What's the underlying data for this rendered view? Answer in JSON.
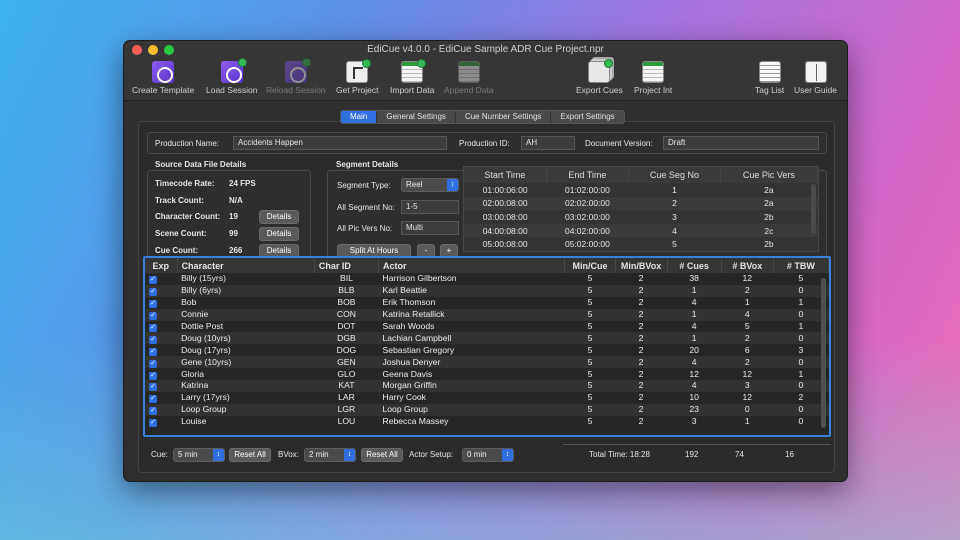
{
  "window": {
    "title": "EdiCue v4.0.0 - EdiCue Sample ADR Cue Project.npr"
  },
  "toolbar": {
    "create_template": "Create Template",
    "load_session": "Load Session",
    "reload_session": "Reload Session",
    "get_project": "Get Project",
    "import_data": "Import Data",
    "append_data": "Append Data",
    "export_cues": "Export Cues",
    "project_int": "Project Int",
    "tag_list": "Tag List",
    "user_guide": "User Guide"
  },
  "tabs": [
    "Main",
    "General Settings",
    "Cue Number Settings",
    "Export Settings"
  ],
  "production": {
    "name_label": "Production Name:",
    "name": "Accidents Happen",
    "id_label": "Production ID:",
    "id": "AH",
    "version_label": "Document Version:",
    "version": "Draft"
  },
  "source": {
    "heading": "Source Data File Details",
    "timecode_label": "Timecode Rate:",
    "timecode": "24 FPS",
    "track_label": "Track Count:",
    "track": "N/A",
    "char_label": "Character Count:",
    "char": "19",
    "scene_label": "Scene Count:",
    "scene": "99",
    "cue_label": "Cue Count:",
    "cue": "266",
    "details": "Details"
  },
  "segment": {
    "heading": "Segment Details",
    "type_label": "Segment Type:",
    "type": "Reel",
    "all_no_label": "All Segment No:",
    "all_no": "1-5",
    "all_pic_label": "All Pic Vers No:",
    "all_pic": "Multi",
    "split_btn": "Split At Hours",
    "minus": "-",
    "plus": "+",
    "columns": [
      "Start Time",
      "End Time",
      "Cue Seg No",
      "Cue Pic Vers"
    ],
    "rows": [
      [
        "01:00:06:00",
        "01:02:00:00",
        "1",
        "2a"
      ],
      [
        "02:00:08:00",
        "02:02:00:00",
        "2",
        "2a"
      ],
      [
        "03:00:08:00",
        "03:02:00:00",
        "3",
        "2b"
      ],
      [
        "04:00:08:00",
        "04:02:00:00",
        "4",
        "2c"
      ],
      [
        "05:00:08:00",
        "05:02:00:00",
        "5",
        "2b"
      ]
    ]
  },
  "characters": {
    "columns": [
      "Exp",
      "Character",
      "Char ID",
      "Actor",
      "Min/Cue",
      "Min/BVox",
      "# Cues",
      "# BVox",
      "# TBW"
    ],
    "rows": [
      [
        "Billy (15yrs)",
        "BIL",
        "Harrison Gilbertson",
        "5",
        "2",
        "38",
        "12",
        "5"
      ],
      [
        "Billy (6yrs)",
        "BLB",
        "Karl Beattie",
        "5",
        "2",
        "1",
        "2",
        "0"
      ],
      [
        "Bob",
        "BOB",
        "Erik Thomson",
        "5",
        "2",
        "4",
        "1",
        "1"
      ],
      [
        "Connie",
        "CON",
        "Katrina Retallick",
        "5",
        "2",
        "1",
        "4",
        "0"
      ],
      [
        "Dottie Post",
        "DOT",
        "Sarah Woods",
        "5",
        "2",
        "4",
        "5",
        "1"
      ],
      [
        "Doug (10yrs)",
        "DGB",
        "Lachian Campbell",
        "5",
        "2",
        "1",
        "2",
        "0"
      ],
      [
        "Doug (17yrs)",
        "DOG",
        "Sebastian Gregory",
        "5",
        "2",
        "20",
        "6",
        "3"
      ],
      [
        "Gene (10yrs)",
        "GEN",
        "Joshua Denyer",
        "5",
        "2",
        "4",
        "2",
        "0"
      ],
      [
        "Gloria",
        "GLO",
        "Geena Davis",
        "5",
        "2",
        "12",
        "12",
        "1"
      ],
      [
        "Katrina",
        "KAT",
        "Morgan Griffin",
        "5",
        "2",
        "4",
        "3",
        "0"
      ],
      [
        "Larry (17yrs)",
        "LAR",
        "Harry Cook",
        "5",
        "2",
        "10",
        "12",
        "2"
      ],
      [
        "Loop Group",
        "LGR",
        "Loop Group",
        "5",
        "2",
        "23",
        "0",
        "0"
      ],
      [
        "Louise",
        "LOU",
        "Rebecca Massey",
        "5",
        "2",
        "3",
        "1",
        "0"
      ]
    ]
  },
  "footer": {
    "cue_label": "Cue:",
    "cue_val": "5 min",
    "reset": "Reset All",
    "bvox_label": "BVox:",
    "bvox_val": "2 min",
    "actor_label": "Actor Setup:",
    "actor_val": "0 min",
    "total_label": "Total Time: 18:28",
    "total_cues": "192",
    "total_bvox": "74",
    "total_tbw": "16"
  }
}
